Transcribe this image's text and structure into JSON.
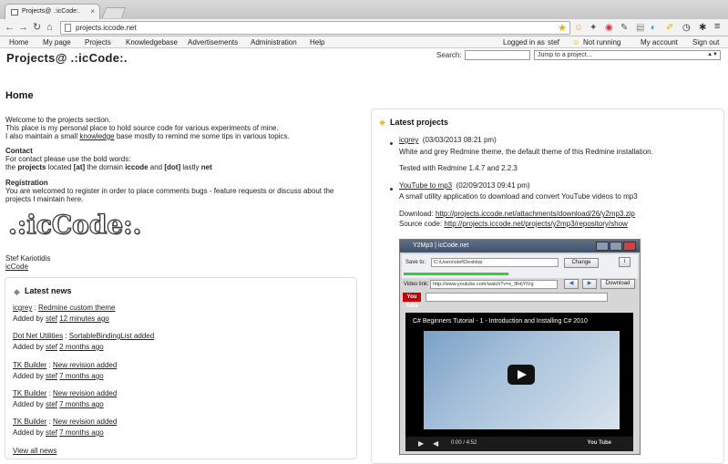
{
  "browser": {
    "tab_title": "Projects@ .:icCode:.",
    "tab_close": "×",
    "url": "projects.iccode.net",
    "nav_back": "←",
    "nav_forward": "→",
    "nav_reload": "↻",
    "nav_home": "⌂",
    "star": "★",
    "menu": "≡"
  },
  "topmenu": {
    "left": [
      "Home",
      "My page",
      "Projects",
      "Knowledgebase",
      "Advertisements",
      "Administration",
      "Help"
    ],
    "logged_in_as": "Logged in as",
    "user": "stef",
    "running": "Not running",
    "my_account": "My account",
    "sign_out": "Sign out"
  },
  "header": {
    "title": "Projects@ .:icCode:.",
    "search_label": "Search:",
    "jump_placeholder": "Jump to a project..."
  },
  "page": {
    "title": "Home",
    "welcome": "Welcome to the projects section.",
    "line2": "This place is my personal place to hold source code for various experiments of mine.",
    "line3a": "I also maintain a small ",
    "line3_link": "knowledge",
    "line3b": "  base mostly to remind me some tips in various topics.",
    "contact_h": "Contact",
    "contact1": "For contact please use the bold words:",
    "contact2": {
      "p1": "the ",
      "b1": "projects",
      "p2": " located ",
      "b2": "[at]",
      "p3": " the domain ",
      "b3": "iccode",
      "p4": " and ",
      "b4": "[dot]",
      "p5": " lastly ",
      "b5": "net"
    },
    "reg_h": "Registration",
    "reg1": "You are welcomed to register in order to place comments bugs - feature requests or discuss about the",
    "reg2": "projects I maintain here.",
    "logo_text": ".:icCode:.",
    "sig_name": "Stef Kariotidis",
    "sig_link": "icCode"
  },
  "news": {
    "heading": "Latest news",
    "items": [
      {
        "project": "icgrey",
        "title": "Redmine custom theme",
        "added": "Added by ",
        "author": "stef",
        "time": "12 minutes ago"
      },
      {
        "project": "Dot Net Utilities",
        "title": "SortableBindingList added",
        "added": "Added by ",
        "author": "stef",
        "time": "2 months ago"
      },
      {
        "project": "TK Builder",
        "title": "New revision added",
        "added": "Added by ",
        "author": "stef",
        "time": "7 months ago"
      },
      {
        "project": "TK Builder",
        "title": "New revision added",
        "added": "Added by ",
        "author": "stef",
        "time": "7 months ago"
      },
      {
        "project": "TK Builder",
        "title": "New revision added",
        "added": "Added by ",
        "author": "stef",
        "time": "7 months ago"
      }
    ],
    "sep": " : ",
    "view_all": "View all news"
  },
  "projects": {
    "heading": "Latest projects",
    "p1": {
      "name": "icgrey",
      "date": "(03/03/2013 08:21 pm)",
      "desc": "White and grey Redmine theme, the default theme of this Redmine installation.",
      "tested": "Tested with Redmine 1.4.7 and 2.2.3"
    },
    "p2": {
      "name": "YouTube to mp3",
      "date": "(02/09/2013 09:41 pm)",
      "desc": "A small utility application to download and convert YouTube videos to mp3",
      "download_label": "Download: ",
      "download_url": "http://projects.iccode.net/attachments/download/26/y2mp3.zip",
      "source_label": "Source code: ",
      "source_url": "http://projects.iccode.net/projects/y2mp3/repository/show"
    }
  },
  "screenshot": {
    "window_title": "Y2Mp3 | icCode.net",
    "save_to": "Save to:",
    "path": "C:\\Users\\stef\\Desktop",
    "change": "Change",
    "info": "i",
    "video_link": "Video link:",
    "link": "http://www.youtube.com/watch?v=x_9lHjYtVg",
    "download": "Download",
    "yt_logo": "You Tube",
    "video_title": "C# Beginners Tutorial - 1 - Introduction and Installing C# 2010",
    "time": "0:00 / 4:52",
    "yt_mark": "You Tube"
  }
}
